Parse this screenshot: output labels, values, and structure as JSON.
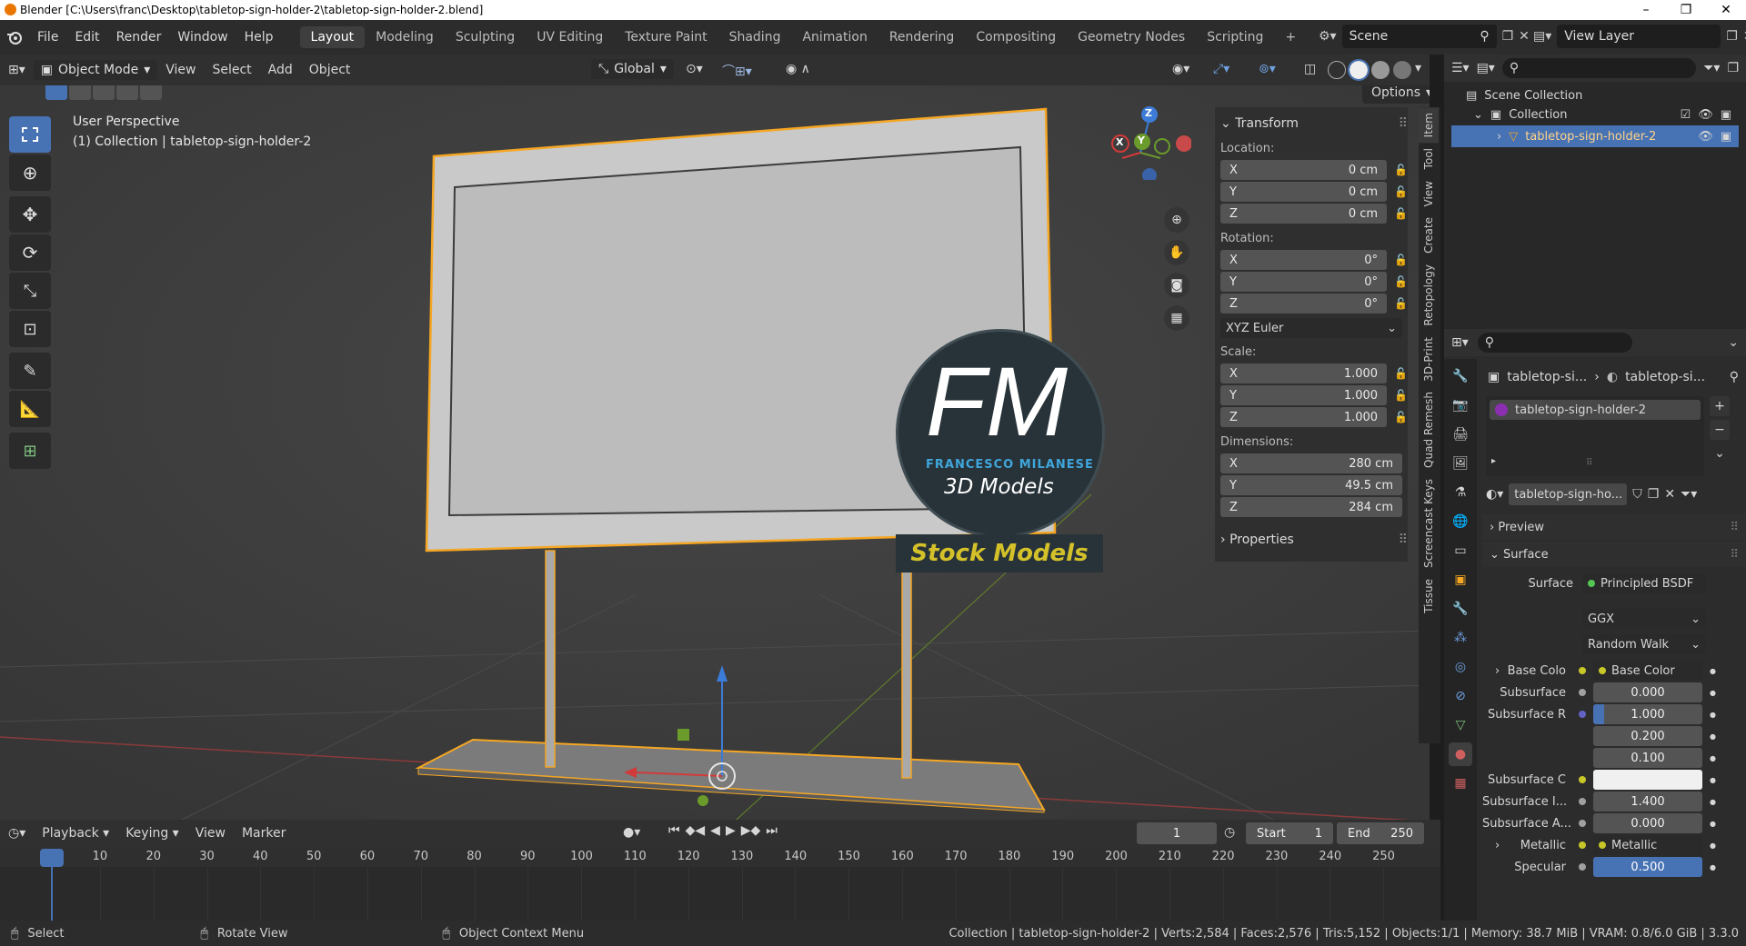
{
  "window": {
    "title": "Blender [C:\\Users\\franc\\Desktop\\tabletop-sign-holder-2\\tabletop-sign-holder-2.blend]"
  },
  "menus": [
    "File",
    "Edit",
    "Render",
    "Window",
    "Help"
  ],
  "workspaces": [
    "Layout",
    "Modeling",
    "Sculpting",
    "UV Editing",
    "Texture Paint",
    "Shading",
    "Animation",
    "Rendering",
    "Compositing",
    "Geometry Nodes",
    "Scripting"
  ],
  "active_workspace": "Layout",
  "scene": {
    "name": "Scene",
    "view_layer": "View Layer"
  },
  "viewport_header": {
    "mode": "Object Mode",
    "menus": [
      "View",
      "Select",
      "Add",
      "Object"
    ],
    "orientation": "Global",
    "options": "Options"
  },
  "viewport": {
    "info_line1": "User Perspective",
    "info_line2": "(1) Collection | tabletop-sign-holder-2",
    "gizmo": {
      "z": "Z",
      "y": "Y",
      "x": "X"
    },
    "watermark": {
      "initials": "FM",
      "name": "FRANCESCO MILANESE",
      "sub": "3D Models",
      "banner": "Stock Models"
    }
  },
  "npanel": {
    "transform_title": "Transform",
    "location_label": "Location:",
    "location": [
      {
        "axis": "X",
        "value": "0 cm"
      },
      {
        "axis": "Y",
        "value": "0 cm"
      },
      {
        "axis": "Z",
        "value": "0 cm"
      }
    ],
    "rotation_label": "Rotation:",
    "rotation": [
      {
        "axis": "X",
        "value": "0°"
      },
      {
        "axis": "Y",
        "value": "0°"
      },
      {
        "axis": "Z",
        "value": "0°"
      }
    ],
    "rotation_mode": "XYZ Euler",
    "scale_label": "Scale:",
    "scale": [
      {
        "axis": "X",
        "value": "1.000"
      },
      {
        "axis": "Y",
        "value": "1.000"
      },
      {
        "axis": "Z",
        "value": "1.000"
      }
    ],
    "dimensions_label": "Dimensions:",
    "dimensions": [
      {
        "axis": "X",
        "value": "280 cm"
      },
      {
        "axis": "Y",
        "value": "49.5 cm"
      },
      {
        "axis": "Z",
        "value": "284 cm"
      }
    ],
    "properties_title": "Properties"
  },
  "side_tabs": [
    "Item",
    "Tool",
    "View",
    "Create",
    "Retopology",
    "3D-Print",
    "Quad Remesh",
    "Screencast Keys",
    "Tissue"
  ],
  "outliner": {
    "scene_collection": "Scene Collection",
    "collection": "Collection",
    "object": "tabletop-sign-holder-2"
  },
  "properties": {
    "breadcrumb_obj": "tabletop-si...",
    "breadcrumb_mat": "tabletop-si...",
    "material_slot": "tabletop-sign-holder-2",
    "material_name": "tabletop-sign-ho...",
    "preview": "Preview",
    "surface_section": "Surface",
    "surface_label": "Surface",
    "surface_value": "Principled BSDF",
    "distribution": "GGX",
    "subsurface_method": "Random Walk",
    "rows": [
      {
        "label": "Base Colo",
        "value": "Base Color",
        "kind": "link"
      },
      {
        "label": "Subsurface",
        "value": "0.000",
        "kind": "num"
      },
      {
        "label": "Subsurface R",
        "value": "1.000",
        "kind": "num"
      },
      {
        "label": "",
        "value": "0.200",
        "kind": "num"
      },
      {
        "label": "",
        "value": "0.100",
        "kind": "num"
      },
      {
        "label": "Subsurface C",
        "value": "",
        "kind": "color"
      },
      {
        "label": "Subsurface I...",
        "value": "1.400",
        "kind": "num"
      },
      {
        "label": "Subsurface A...",
        "value": "0.000",
        "kind": "num"
      },
      {
        "label": "Metallic",
        "value": "Metallic",
        "kind": "link"
      },
      {
        "label": "Specular",
        "value": "0.500",
        "kind": "slider"
      }
    ]
  },
  "timeline": {
    "menus": [
      "Playback",
      "Keying",
      "View",
      "Marker"
    ],
    "current_frame": "1",
    "start_label": "Start",
    "start": "1",
    "end_label": "End",
    "end": "250",
    "ticks": [
      "1",
      "10",
      "20",
      "30",
      "40",
      "50",
      "60",
      "70",
      "80",
      "90",
      "100",
      "110",
      "120",
      "130",
      "140",
      "150",
      "160",
      "170",
      "180",
      "190",
      "200",
      "210",
      "220",
      "230",
      "240",
      "250"
    ]
  },
  "statusbar": {
    "select": "Select",
    "rotate": "Rotate View",
    "context": "Object Context Menu",
    "stats": "Collection | tabletop-sign-holder-2 | Verts:2,584 | Faces:2,576 | Tris:5,152 | Objects:1/1 | Memory: 38.7 MiB | VRAM: 0.8/6.0 GiB | 3.3.0"
  },
  "colors": {
    "accent": "#4772b3",
    "selected_outline": "#f5a623",
    "blender_orange": "#ea7600"
  }
}
